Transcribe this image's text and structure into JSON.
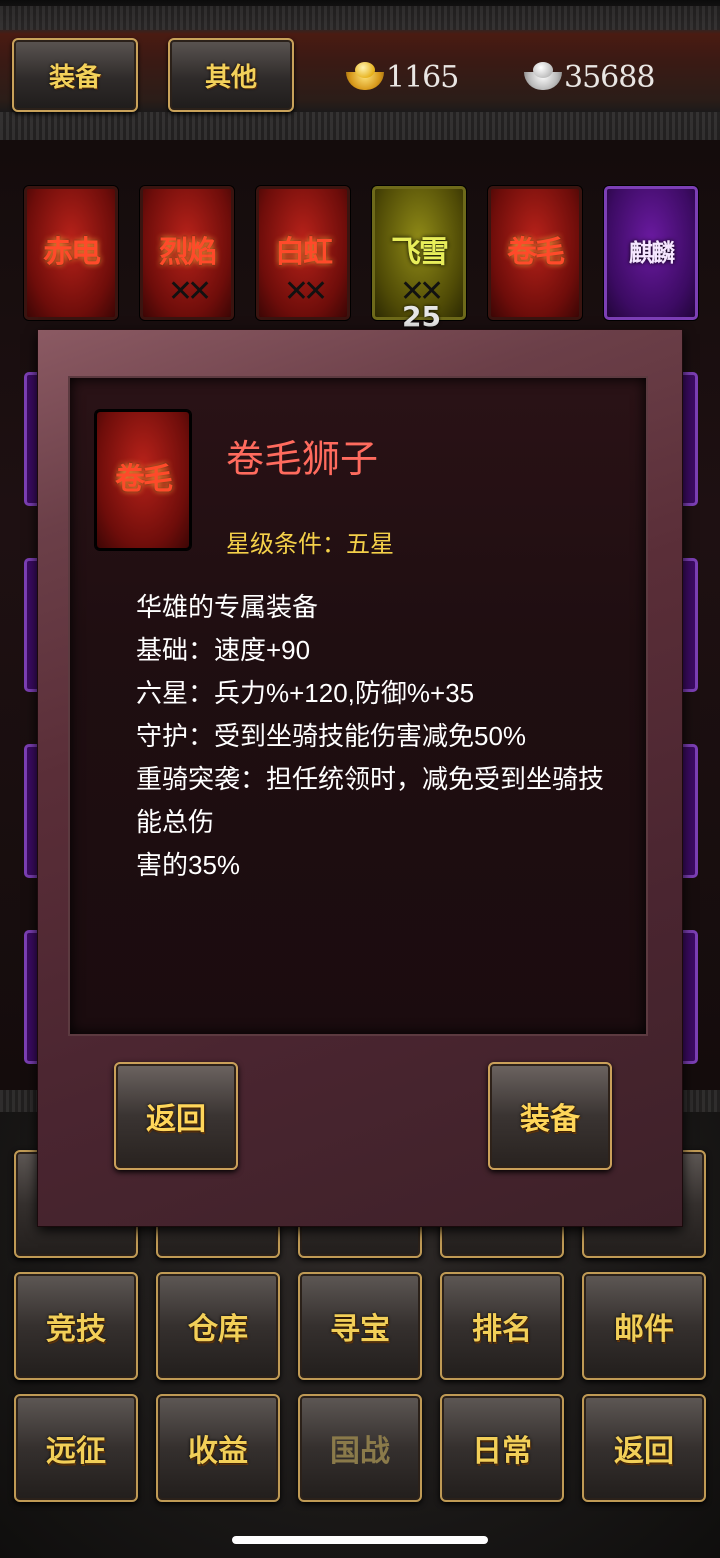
{
  "top": {
    "tabs": [
      "装备",
      "其他"
    ],
    "gold": "1165",
    "silver": "35688"
  },
  "equipment_row": [
    {
      "name": "赤电",
      "style": "red"
    },
    {
      "name": "烈焰",
      "style": "red"
    },
    {
      "name": "白虹",
      "style": "red"
    },
    {
      "name": "飞雪",
      "style": "yellow",
      "level": "25"
    },
    {
      "name": "卷毛",
      "style": "red"
    },
    {
      "name": "麒麟",
      "style": "purple"
    }
  ],
  "dialog": {
    "icon_name": "卷毛",
    "title": "卷毛狮子",
    "star_requirement": "星级条件：五星",
    "description": [
      "华雄的专属装备",
      "基础：速度+90",
      "六星：兵力%+120,防御%+35",
      "守护：受到坐骑技能伤害减免50%",
      "重骑突袭：担任统领时，减免受到坐骑技能总伤",
      "害的35%"
    ],
    "back_label": "返回",
    "equip_label": "装备"
  },
  "bottom_menu": {
    "row1": [
      "竞技",
      "仓库",
      "寻宝",
      "排名",
      "邮件"
    ],
    "row2": [
      "远征",
      "收益",
      "国战",
      "日常",
      "返回"
    ]
  }
}
